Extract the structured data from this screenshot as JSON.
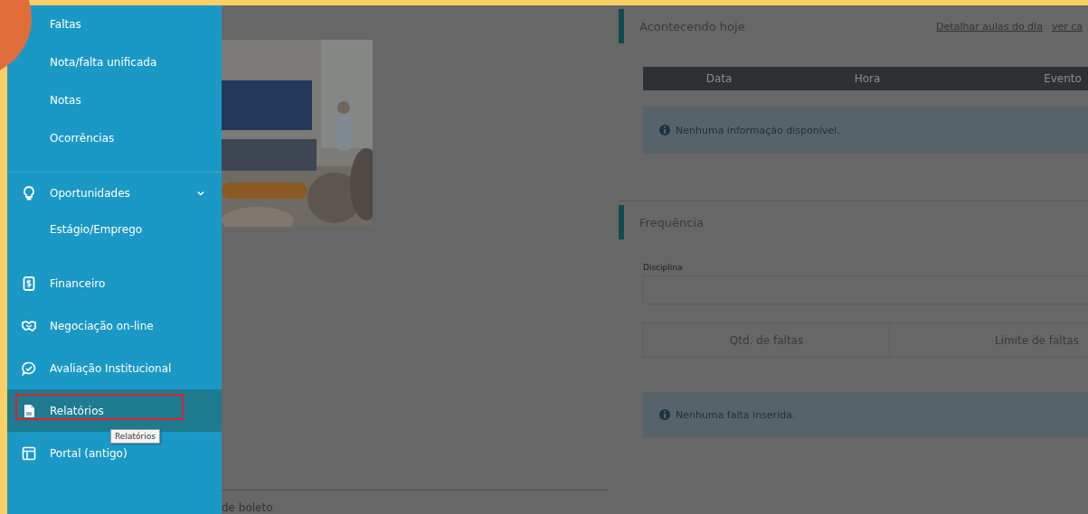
{
  "sidebar": {
    "items": [
      {
        "label": "Faltas",
        "kind": "sublink",
        "selected": false,
        "highlighted": false
      },
      {
        "label": "Nota/falta unificada",
        "kind": "sublink",
        "selected": false,
        "highlighted": false
      },
      {
        "label": "Notas",
        "kind": "sublink",
        "selected": false,
        "highlighted": false
      },
      {
        "label": "Ocorrências",
        "kind": "sublink",
        "selected": false,
        "highlighted": false
      },
      {
        "label": "Oportunidades",
        "kind": "bulb",
        "selected": false,
        "highlighted": false,
        "expanded": true,
        "children": [
          {
            "label": "Estágio/Emprego",
            "selected": false
          }
        ]
      },
      {
        "label": "Financeiro",
        "kind": "money",
        "selected": false,
        "highlighted": false
      },
      {
        "label": "Negociação on-line",
        "kind": "handshake",
        "selected": false,
        "highlighted": false
      },
      {
        "label": "Avaliação Institucional",
        "kind": "chat",
        "selected": false,
        "highlighted": false
      },
      {
        "label": "Relatórios",
        "kind": "document",
        "selected": true,
        "highlighted": true,
        "tooltip": "Relatórios"
      },
      {
        "label": "Portal (antigo)",
        "kind": "layout",
        "selected": false,
        "highlighted": false
      }
    ]
  },
  "main": {
    "footer_text": "de boleto",
    "panels": [
      {
        "title": "Acontecendo hoje",
        "links": [
          "Detalhar aulas do dia",
          "ver ca"
        ],
        "table": {
          "kind": "dark",
          "columns": [
            "Data",
            "Hora",
            "Evento"
          ]
        },
        "alert": "Nenhuma informação disponível."
      },
      {
        "title": "Frequência",
        "field": {
          "label": "Disciplina"
        },
        "table": {
          "kind": "bordered",
          "columns": [
            "Qtd. de faltas",
            "Limite de faltas"
          ]
        },
        "alert": "Nenhuma falta inserida."
      }
    ]
  }
}
